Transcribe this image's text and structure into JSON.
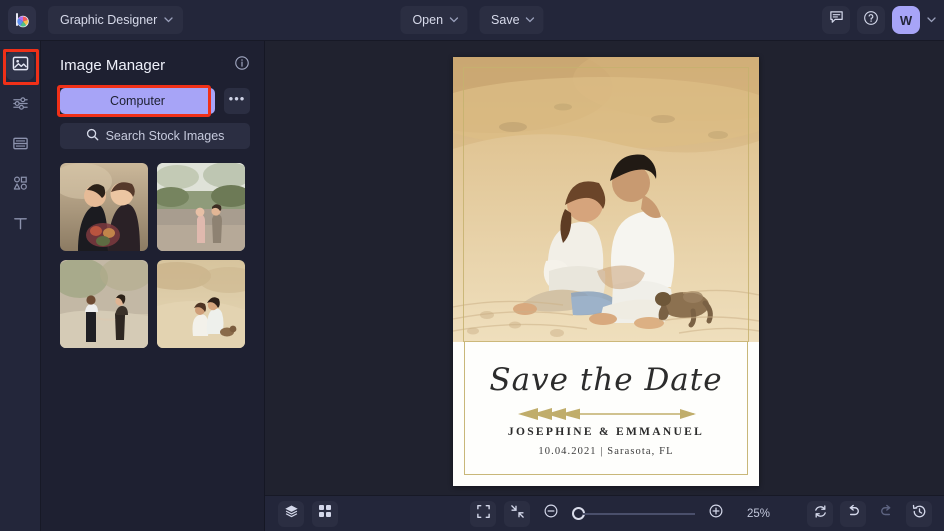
{
  "topbar": {
    "logo_name": "logo-mark",
    "app_name": "Graphic Designer",
    "open_label": "Open",
    "save_label": "Save",
    "chat_icon": "chat-icon",
    "help_icon": "help-icon",
    "avatar_initial": "W",
    "caret": "∨"
  },
  "rail": {
    "items": [
      {
        "name": "image-manager",
        "icon": "image-icon"
      },
      {
        "name": "adjustments",
        "icon": "sliders-icon"
      },
      {
        "name": "frames",
        "icon": "frames-icon"
      },
      {
        "name": "shapes",
        "icon": "shapes-icon"
      },
      {
        "name": "text",
        "icon": "text-icon",
        "glyph": "T"
      }
    ]
  },
  "panel": {
    "title": "Image Manager",
    "info_icon": "info-icon",
    "computer_label": "Computer",
    "more_label": "•••",
    "search_label": "Search Stock Images",
    "search_icon": "search-icon",
    "thumbnails": [
      {
        "name": "thumb-couple-formal-bouquet"
      },
      {
        "name": "thumb-couple-lake"
      },
      {
        "name": "thumb-couple-holding-hands"
      },
      {
        "name": "thumb-couple-dunes"
      }
    ]
  },
  "card": {
    "heading": "Save the Date",
    "ornament": "arrow-ornament",
    "names": "JOSEPHINE & EMMANUEL",
    "meta": "10.04.2021 | Sarasota, FL",
    "photo_alt": "couple-sitting-on-sand-dunes-with-puppy"
  },
  "bottombar": {
    "layers_icon": "layers-icon",
    "grid_icon": "grid-icon",
    "fit_icon": "fit-screen-icon",
    "shrink_icon": "shrink-icon",
    "zoom_out_icon": "zoom-out-icon",
    "zoom_in_icon": "zoom-in-icon",
    "zoom_value": "25%",
    "reset_icon": "reset-icon",
    "undo_icon": "undo-icon",
    "redo_icon": "redo-icon",
    "history_icon": "history-icon"
  },
  "colors": {
    "accent": "#a7a4f7",
    "bg": "#1b1d2a",
    "panel": "#1e2031",
    "bar": "#23263a",
    "highlight": "#f03018",
    "gold": "#c8b779"
  }
}
